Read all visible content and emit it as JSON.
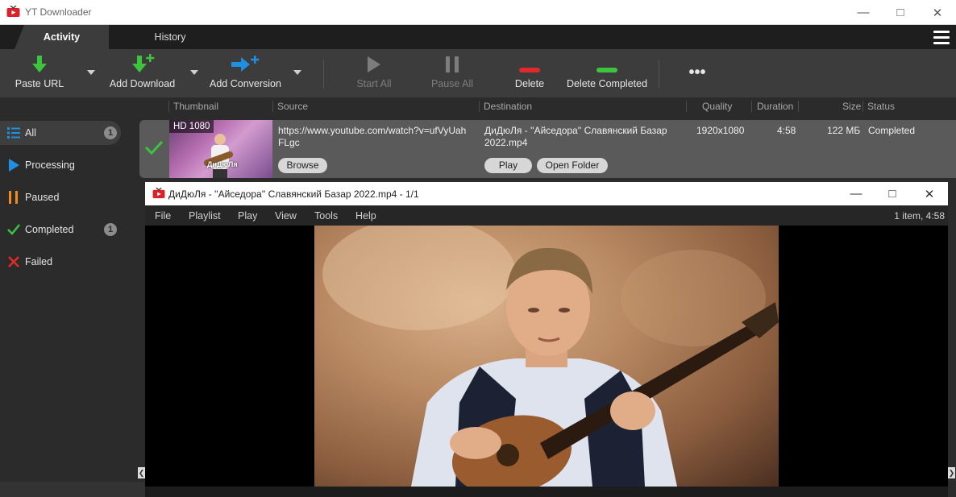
{
  "app": {
    "title": "YT Downloader",
    "accent_green": "#2fc53a",
    "accent_blue": "#1f8fe0"
  },
  "tabs": [
    {
      "label": "Activity",
      "active": true
    },
    {
      "label": "History",
      "active": false
    }
  ],
  "toolbar": {
    "paste_url": "Paste URL",
    "add_download": "Add Download",
    "add_conversion": "Add Conversion",
    "start_all": "Start All",
    "pause_all": "Pause All",
    "delete": "Delete",
    "delete_completed": "Delete Completed",
    "more": "•••"
  },
  "columns": {
    "thumbnail": "Thumbnail",
    "source": "Source",
    "destination": "Destination",
    "quality": "Quality",
    "duration": "Duration",
    "size": "Size",
    "status": "Status"
  },
  "sidebar": {
    "items": [
      {
        "label": "All",
        "count": "1",
        "icon": "list-icon"
      },
      {
        "label": "Processing",
        "count": "",
        "icon": "play-icon"
      },
      {
        "label": "Paused",
        "count": "",
        "icon": "pause-icon"
      },
      {
        "label": "Completed",
        "count": "1",
        "icon": "check-icon"
      },
      {
        "label": "Failed",
        "count": "",
        "icon": "cross-icon"
      }
    ]
  },
  "download": {
    "badge": "HD 1080",
    "thumb_caption": "ДиДюЛя",
    "source_line1": "https://www.youtube.com/watch?v=ufVyUah",
    "source_line2": "FLgc",
    "dest_line1": "ДиДюЛя - ''Айседора'' Славянский Базар",
    "dest_line2": "2022.mp4",
    "quality": "1920x1080",
    "duration": "4:58",
    "size": "122 МБ",
    "status": "Completed",
    "browse": "Browse",
    "play": "Play",
    "open_folder": "Open Folder"
  },
  "player": {
    "title": "ДиДюЛя - ''Айседора'' Славянский Базар 2022.mp4 - 1/1",
    "menu": [
      "File",
      "Playlist",
      "Play",
      "View",
      "Tools",
      "Help"
    ],
    "info": "1 item, 4:58"
  }
}
